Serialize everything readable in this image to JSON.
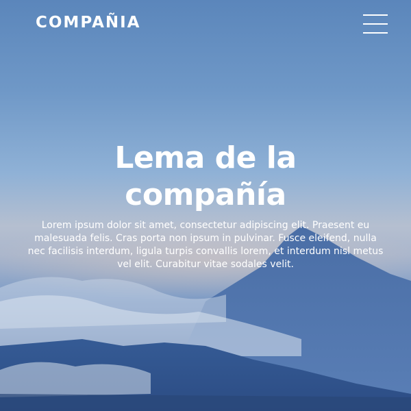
{
  "header": {
    "logo_text": "COMPAÑIA",
    "menu_icon": "hamburger-menu-icon"
  },
  "hero": {
    "headline": "Lema de la compañía",
    "description": "Lorem ipsum dolor sit amet, consectetur adipiscing elit. Praesent eu malesuada felis. Cras porta non ipsum in pulvinar. Fusce eleifend, nulla nec facilisis interdum, ligula turpis convallis lorem, et interdum nisl metus vel elit. Curabitur vitae sodales velit.",
    "background": "mountain-landscape-image"
  },
  "colors": {
    "text": "#ffffff",
    "sky_top": "#5b86bb",
    "sky_horizon": "#b5bfd0",
    "mountains": "#3a5a92"
  }
}
